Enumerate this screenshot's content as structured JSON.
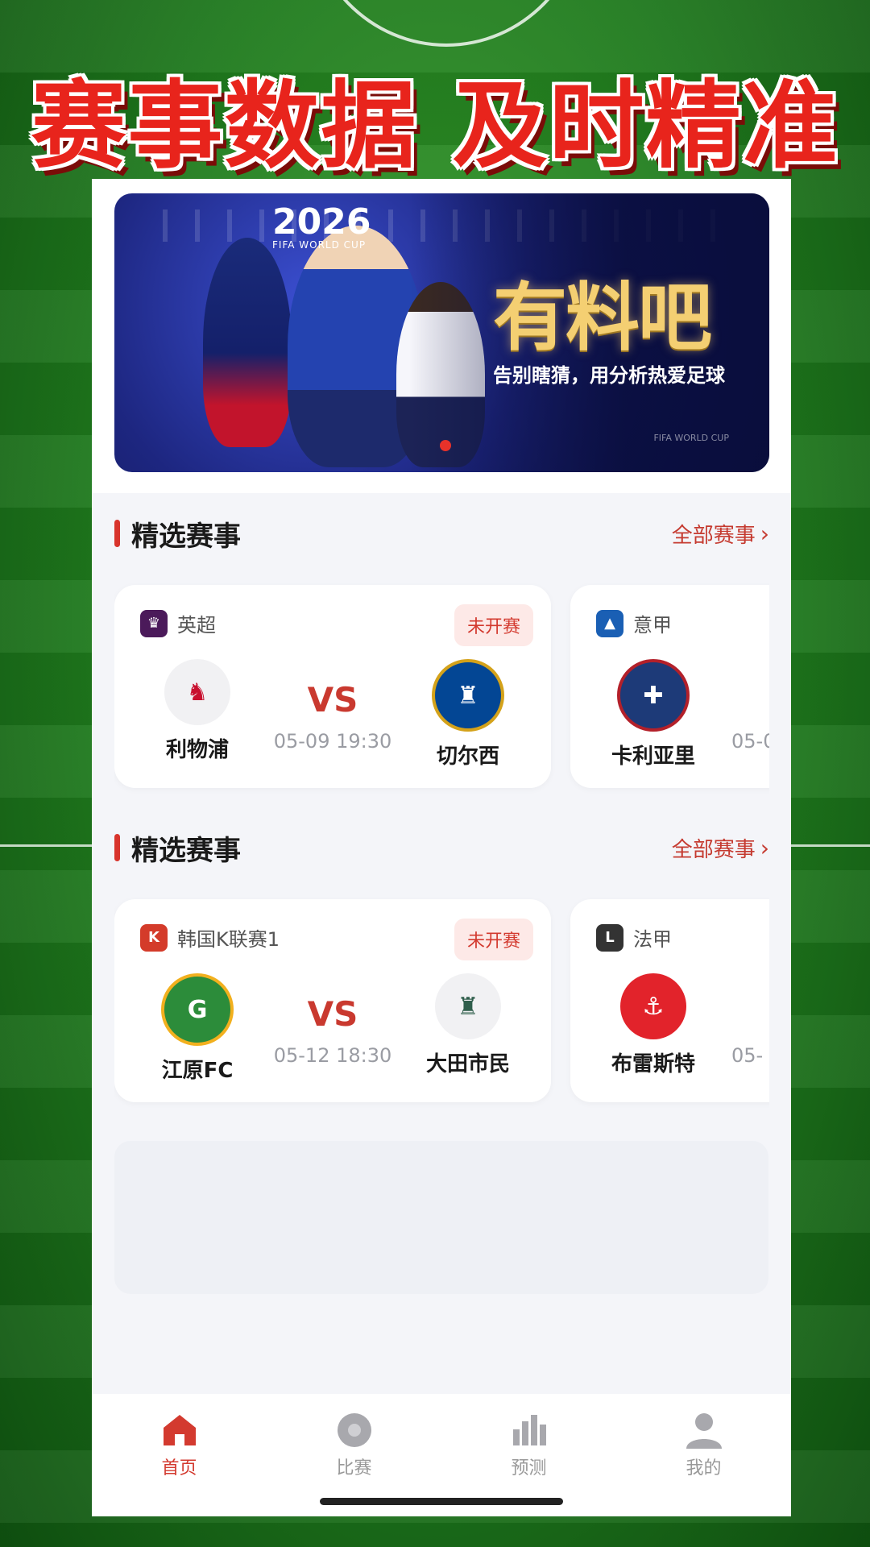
{
  "headline": "赛事数据 及时精准",
  "banner": {
    "year": "2026",
    "cup": "FIFA WORLD CUP",
    "title": "有料吧",
    "subtitle": "告别瞎猜，用分析热爱足球",
    "cup_corner": "FIFA WORLD CUP"
  },
  "sections": [
    {
      "title": "精选赛事",
      "more": "全部赛事",
      "cards": [
        {
          "league": "英超",
          "league_color": "#4b1a5a",
          "status": "未开赛",
          "home": "利物浦",
          "home_color": "#c8102e",
          "away": "切尔西",
          "away_color": "#034694",
          "vs": "VS",
          "time": "05-09 19:30"
        },
        {
          "league": "意甲",
          "league_color": "#1a5fb4",
          "home": "卡利亚里",
          "home_color": "#1d3a78",
          "time_partial": "05-0"
        }
      ]
    },
    {
      "title": "精选赛事",
      "more": "全部赛事",
      "cards": [
        {
          "league": "韩国K联赛1",
          "league_color": "#d43b2a",
          "status": "未开赛",
          "home": "江原FC",
          "home_color": "#2c8c3a",
          "away": "大田市民",
          "away_color": "#2f5e4b",
          "vs": "VS",
          "time": "05-12 18:30"
        },
        {
          "league": "法甲",
          "league_color": "#333333",
          "home": "布雷斯特",
          "home_color": "#e2232b",
          "time_partial": "05-"
        }
      ]
    }
  ],
  "tabs": [
    {
      "label": "首页",
      "icon": "home-icon",
      "active": true
    },
    {
      "label": "比赛",
      "icon": "football-icon",
      "active": false
    },
    {
      "label": "预测",
      "icon": "chart-icon",
      "active": false
    },
    {
      "label": "我的",
      "icon": "user-icon",
      "active": false
    }
  ],
  "colors": {
    "accent": "#d33a2f",
    "inactive": "#a8a8ad"
  }
}
